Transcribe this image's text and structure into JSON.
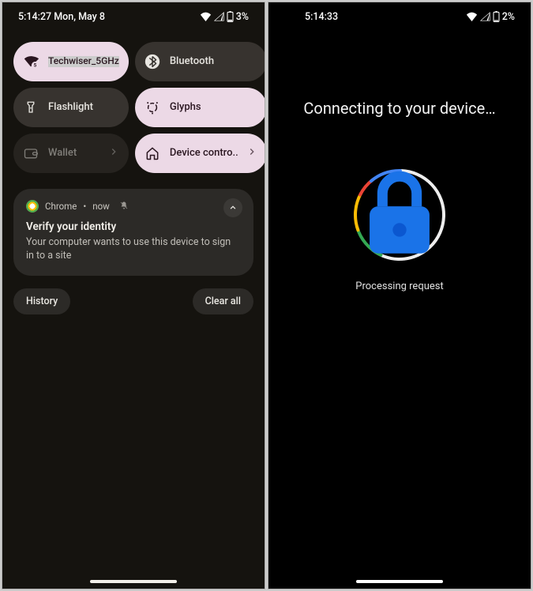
{
  "left": {
    "status": {
      "time_date": "5:14:27 Mon, May 8",
      "battery": "3%"
    },
    "tiles": {
      "wifi": {
        "label": "Techwiser_5GHz"
      },
      "bt": {
        "label": "Bluetooth"
      },
      "flash": {
        "label": "Flashlight"
      },
      "glyphs": {
        "label": "Glyphs"
      },
      "wallet": {
        "label": "Wallet"
      },
      "device": {
        "label": "Device contro.."
      }
    },
    "notif": {
      "app": "Chrome",
      "time": "now",
      "title": "Verify your identity",
      "body": "Your computer wants to use this device to sign in to a site"
    },
    "actions": {
      "history": "History",
      "clear": "Clear all"
    }
  },
  "right": {
    "status": {
      "time": "5:14:33",
      "battery": "2%"
    },
    "title": "Connecting to your device…",
    "processing": "Processing request"
  }
}
